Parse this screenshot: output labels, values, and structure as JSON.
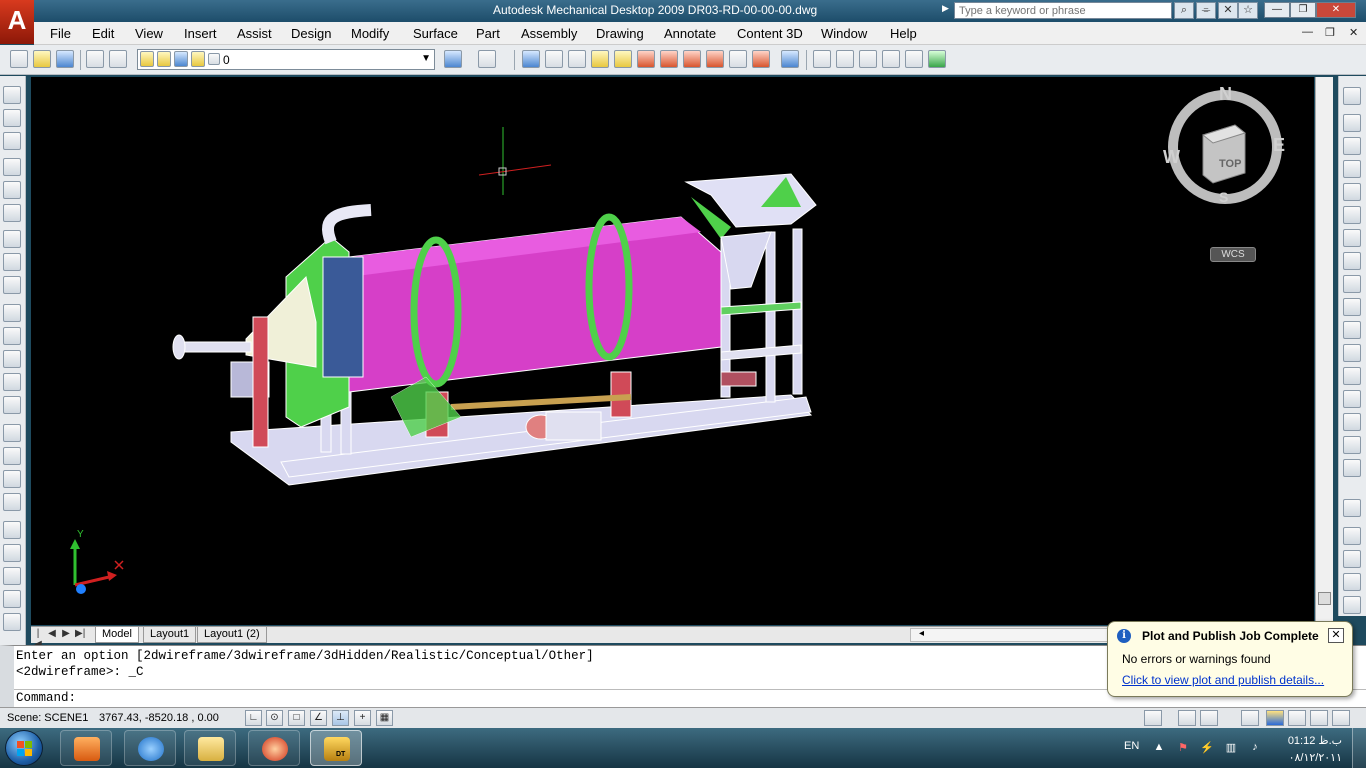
{
  "window": {
    "title": "Autodesk Mechanical Desktop 2009 DR03-RD-00-00-00.dwg",
    "logo_letter": "A",
    "search_placeholder": "Type a keyword or phrase"
  },
  "menu": {
    "items": [
      "File",
      "Edit",
      "View",
      "Insert",
      "Assist",
      "Design",
      "Modify",
      "Surface",
      "Part",
      "Assembly",
      "Drawing",
      "Annotate",
      "Content 3D",
      "Window",
      "Help"
    ]
  },
  "toolbar": {
    "layer_value": "0"
  },
  "viewcube": {
    "north": "N",
    "south": "S",
    "east": "E",
    "west": "W",
    "face": "TOP",
    "ucs_label": "WCS"
  },
  "ucs_icon": {
    "y_label": "Y"
  },
  "tabs": {
    "items": [
      "Model",
      "Layout1",
      "Layout1 (2)"
    ],
    "active": "Model"
  },
  "command": {
    "line1": "Enter an option [2dwireframe/3dwireframe/3dHidden/Realistic/Conceptual/Other]",
    "line2": "<2dwireframe>: _C",
    "prompt": "Command:"
  },
  "notification": {
    "title": "Plot and Publish Job Complete",
    "message": "No errors or warnings found",
    "link": "Click to view plot and publish details..."
  },
  "status": {
    "scene": "Scene: SCENE1",
    "coordinates": "3767.43, -8520.18 , 0.00"
  },
  "taskbar": {
    "app_badge": "DT",
    "language": "EN",
    "time": "01:12 ب.ظ",
    "date": "۰۸/۱۲/۲۰۱۱"
  },
  "colors": {
    "drawing_background": "#000000",
    "drum": "#d63fc8",
    "frame": "#e0e0f5",
    "ring": "#4fd04a",
    "titlebar": "#1d4d6a"
  }
}
